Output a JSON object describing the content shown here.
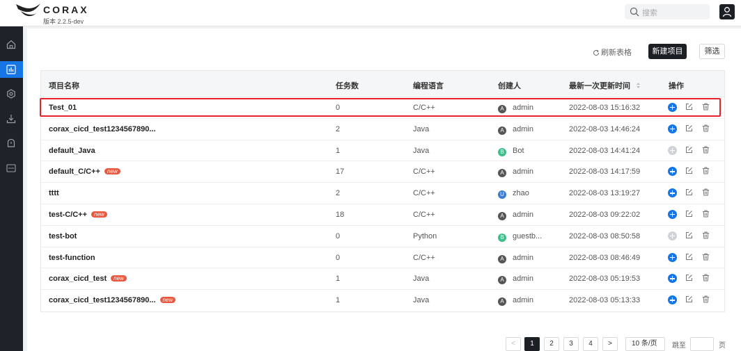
{
  "header": {
    "brand": "CORAX",
    "version": "版本 2.2.5-dev",
    "search_placeholder": "搜索"
  },
  "sidebar": {
    "items": [
      {
        "icon": "home-icon",
        "active": false
      },
      {
        "icon": "chart-icon",
        "active": true
      },
      {
        "icon": "settings-icon",
        "active": false
      },
      {
        "icon": "download-icon",
        "active": false
      },
      {
        "icon": "bell-icon",
        "active": false
      },
      {
        "icon": "log-icon",
        "active": false
      }
    ]
  },
  "toolbar": {
    "refresh_label": "刷新表格",
    "new_project_label": "新建项目",
    "filter_label": "筛选"
  },
  "table": {
    "columns": [
      "项目名称",
      "任务数",
      "编程语言",
      "创建人",
      "最新一次更新时间",
      "操作"
    ],
    "rows": [
      {
        "name": "Test_01",
        "new": false,
        "tasks": "0",
        "lang": "C/C++",
        "avatar": "A",
        "avatar_color": "#555555",
        "creator": "admin",
        "updated": "2022-08-03 15:16:32",
        "add_enabled": true
      },
      {
        "name": "corax_cicd_test1234567890...",
        "new": false,
        "tasks": "2",
        "lang": "Java",
        "avatar": "A",
        "avatar_color": "#555555",
        "creator": "admin",
        "updated": "2022-08-03 14:46:24",
        "add_enabled": true
      },
      {
        "name": "default_Java",
        "new": false,
        "tasks": "1",
        "lang": "Java",
        "avatar": "B",
        "avatar_color": "#3dbf8a",
        "creator": "Bot",
        "updated": "2022-08-03 14:41:24",
        "add_enabled": false
      },
      {
        "name": "default_C/C++",
        "new": true,
        "tasks": "17",
        "lang": "C/C++",
        "avatar": "A",
        "avatar_color": "#555555",
        "creator": "admin",
        "updated": "2022-08-03 14:17:59",
        "add_enabled": true
      },
      {
        "name": "tttt",
        "new": false,
        "tasks": "2",
        "lang": "C/C++",
        "avatar": "U",
        "avatar_color": "#3a7bd5",
        "creator": "zhao",
        "updated": "2022-08-03 13:19:27",
        "add_enabled": true
      },
      {
        "name": "test-C/C++",
        "new": true,
        "tasks": "18",
        "lang": "C/C++",
        "avatar": "A",
        "avatar_color": "#555555",
        "creator": "admin",
        "updated": "2022-08-03 09:22:02",
        "add_enabled": true
      },
      {
        "name": "test-bot",
        "new": false,
        "tasks": "0",
        "lang": "Python",
        "avatar": "B",
        "avatar_color": "#3dbf8a",
        "creator": "guestb...",
        "updated": "2022-08-03 08:50:58",
        "add_enabled": false
      },
      {
        "name": "test-function",
        "new": false,
        "tasks": "0",
        "lang": "C/C++",
        "avatar": "A",
        "avatar_color": "#555555",
        "creator": "admin",
        "updated": "2022-08-03 08:46:49",
        "add_enabled": true
      },
      {
        "name": "corax_cicd_test",
        "new": true,
        "tasks": "1",
        "lang": "Java",
        "avatar": "A",
        "avatar_color": "#555555",
        "creator": "admin",
        "updated": "2022-08-03 05:19:53",
        "add_enabled": true
      },
      {
        "name": "corax_cicd_test1234567890...",
        "new": true,
        "tasks": "1",
        "lang": "Java",
        "avatar": "A",
        "avatar_color": "#555555",
        "creator": "admin",
        "updated": "2022-08-03 05:13:33",
        "add_enabled": true
      }
    ],
    "new_badge": "new"
  },
  "pagination": {
    "prev": "<",
    "pages": [
      "1",
      "2",
      "3",
      "4"
    ],
    "current": "1",
    "next": ">",
    "page_size": "10 条/页",
    "jump_label": "跳至",
    "page_suffix": "页"
  },
  "colors": {
    "primary": "#1676e6",
    "dark": "#1c1f24",
    "highlight": "#e8222a"
  }
}
